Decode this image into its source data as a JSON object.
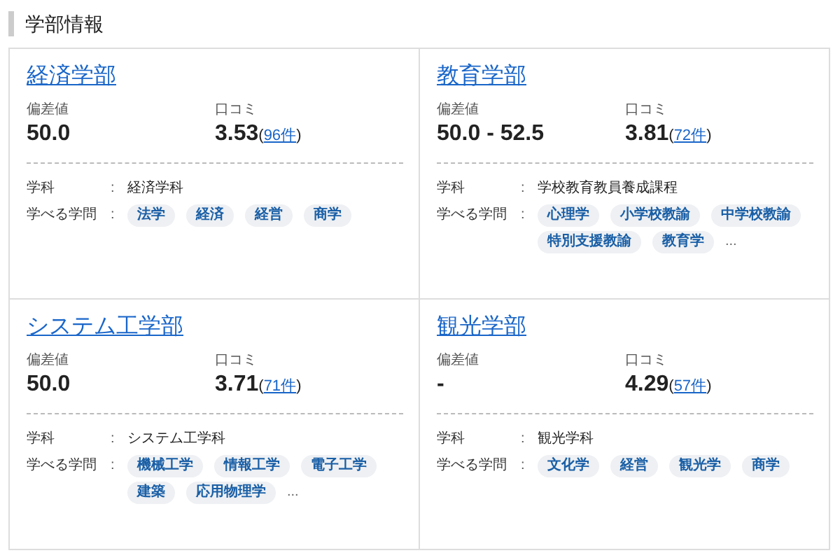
{
  "section_title": "学部情報",
  "faculties": [
    {
      "name": "経済学部",
      "score_label": "偏差値",
      "score": "50.0",
      "review_label": "口コミ",
      "rating": "3.53",
      "paren_open": "(",
      "review_count": "96件",
      "paren_close": ")",
      "dept_label": "学科",
      "colon": ":",
      "dept": "経済学科",
      "subjects_label": "学べる学問",
      "subjects_colon": ":",
      "subjects": [
        "法学",
        "経済",
        "経営",
        "商学"
      ]
    },
    {
      "name": "教育学部",
      "score_label": "偏差値",
      "score": "50.0 - 52.5",
      "review_label": "口コミ",
      "rating": "3.81",
      "paren_open": "(",
      "review_count": "72件",
      "paren_close": ")",
      "dept_label": "学科",
      "colon": ":",
      "dept": "学校教育教員養成課程",
      "subjects_label": "学べる学問",
      "subjects_colon": ":",
      "subjects": [
        "心理学",
        "小学校教諭",
        "中学校教諭",
        "特別支援教諭",
        "教育学"
      ],
      "more": "..."
    },
    {
      "name": "システム工学部",
      "score_label": "偏差値",
      "score": "50.0",
      "review_label": "口コミ",
      "rating": "3.71",
      "paren_open": "(",
      "review_count": "71件",
      "paren_close": ")",
      "dept_label": "学科",
      "colon": ":",
      "dept": "システム工学科",
      "subjects_label": "学べる学問",
      "subjects_colon": ":",
      "subjects": [
        "機械工学",
        "情報工学",
        "電子工学",
        "建築",
        "応用物理学"
      ],
      "more": "..."
    },
    {
      "name": "観光学部",
      "score_label": "偏差値",
      "score": "-",
      "review_label": "口コミ",
      "rating": "4.29",
      "paren_open": "(",
      "review_count": "57件",
      "paren_close": ")",
      "dept_label": "学科",
      "colon": ":",
      "dept": "観光学科",
      "subjects_label": "学べる学問",
      "subjects_colon": ":",
      "subjects": [
        "文化学",
        "経営",
        "観光学",
        "商学"
      ]
    }
  ]
}
